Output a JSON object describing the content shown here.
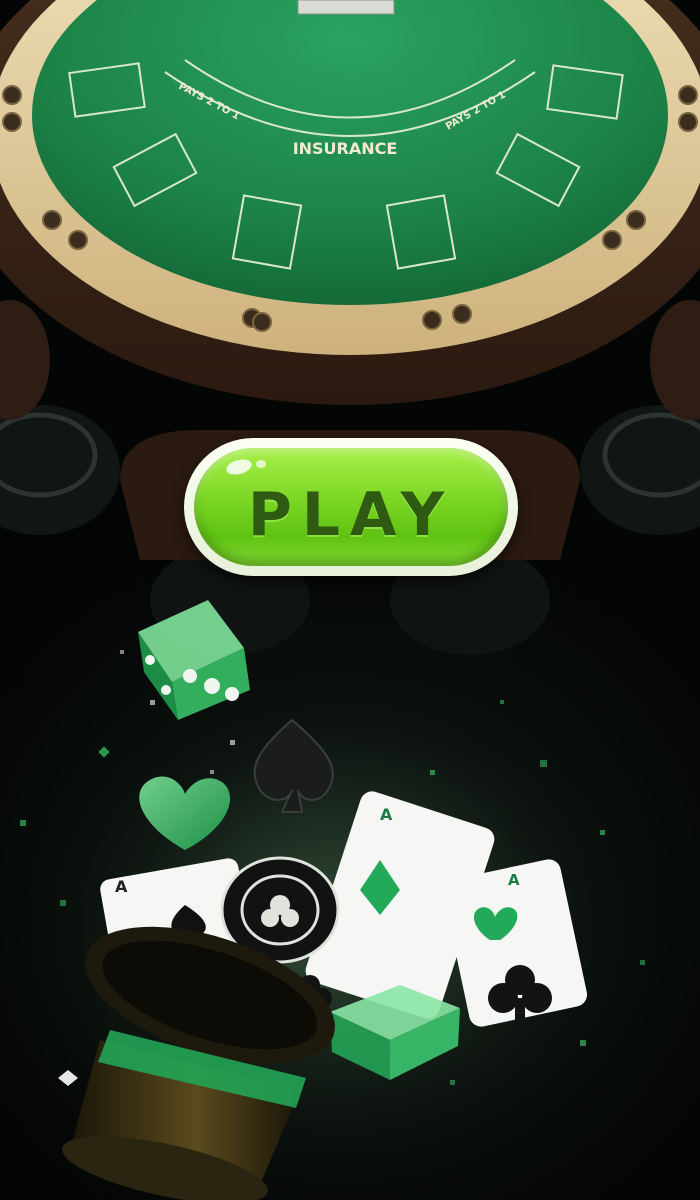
{
  "table": {
    "insurance_label": "INSURANCE",
    "pays_left": "PAYS 2 TO 1",
    "pays_right": "PAYS 2 TO 1"
  },
  "play_button": {
    "label": "PLAY"
  },
  "cards": {
    "rank_a": "A",
    "rank_a2": "A",
    "rank_a3": "A"
  },
  "colors": {
    "felt": "#1f8a4c",
    "rail": "#e2cda0",
    "wood": "#3a2619",
    "button_green": "#7ad623",
    "accent_green": "#1fa85a"
  },
  "icons": [
    "dice-icon",
    "spade-icon",
    "heart-icon",
    "club-icon",
    "diamond-icon",
    "poker-chip-icon",
    "top-hat-icon"
  ]
}
